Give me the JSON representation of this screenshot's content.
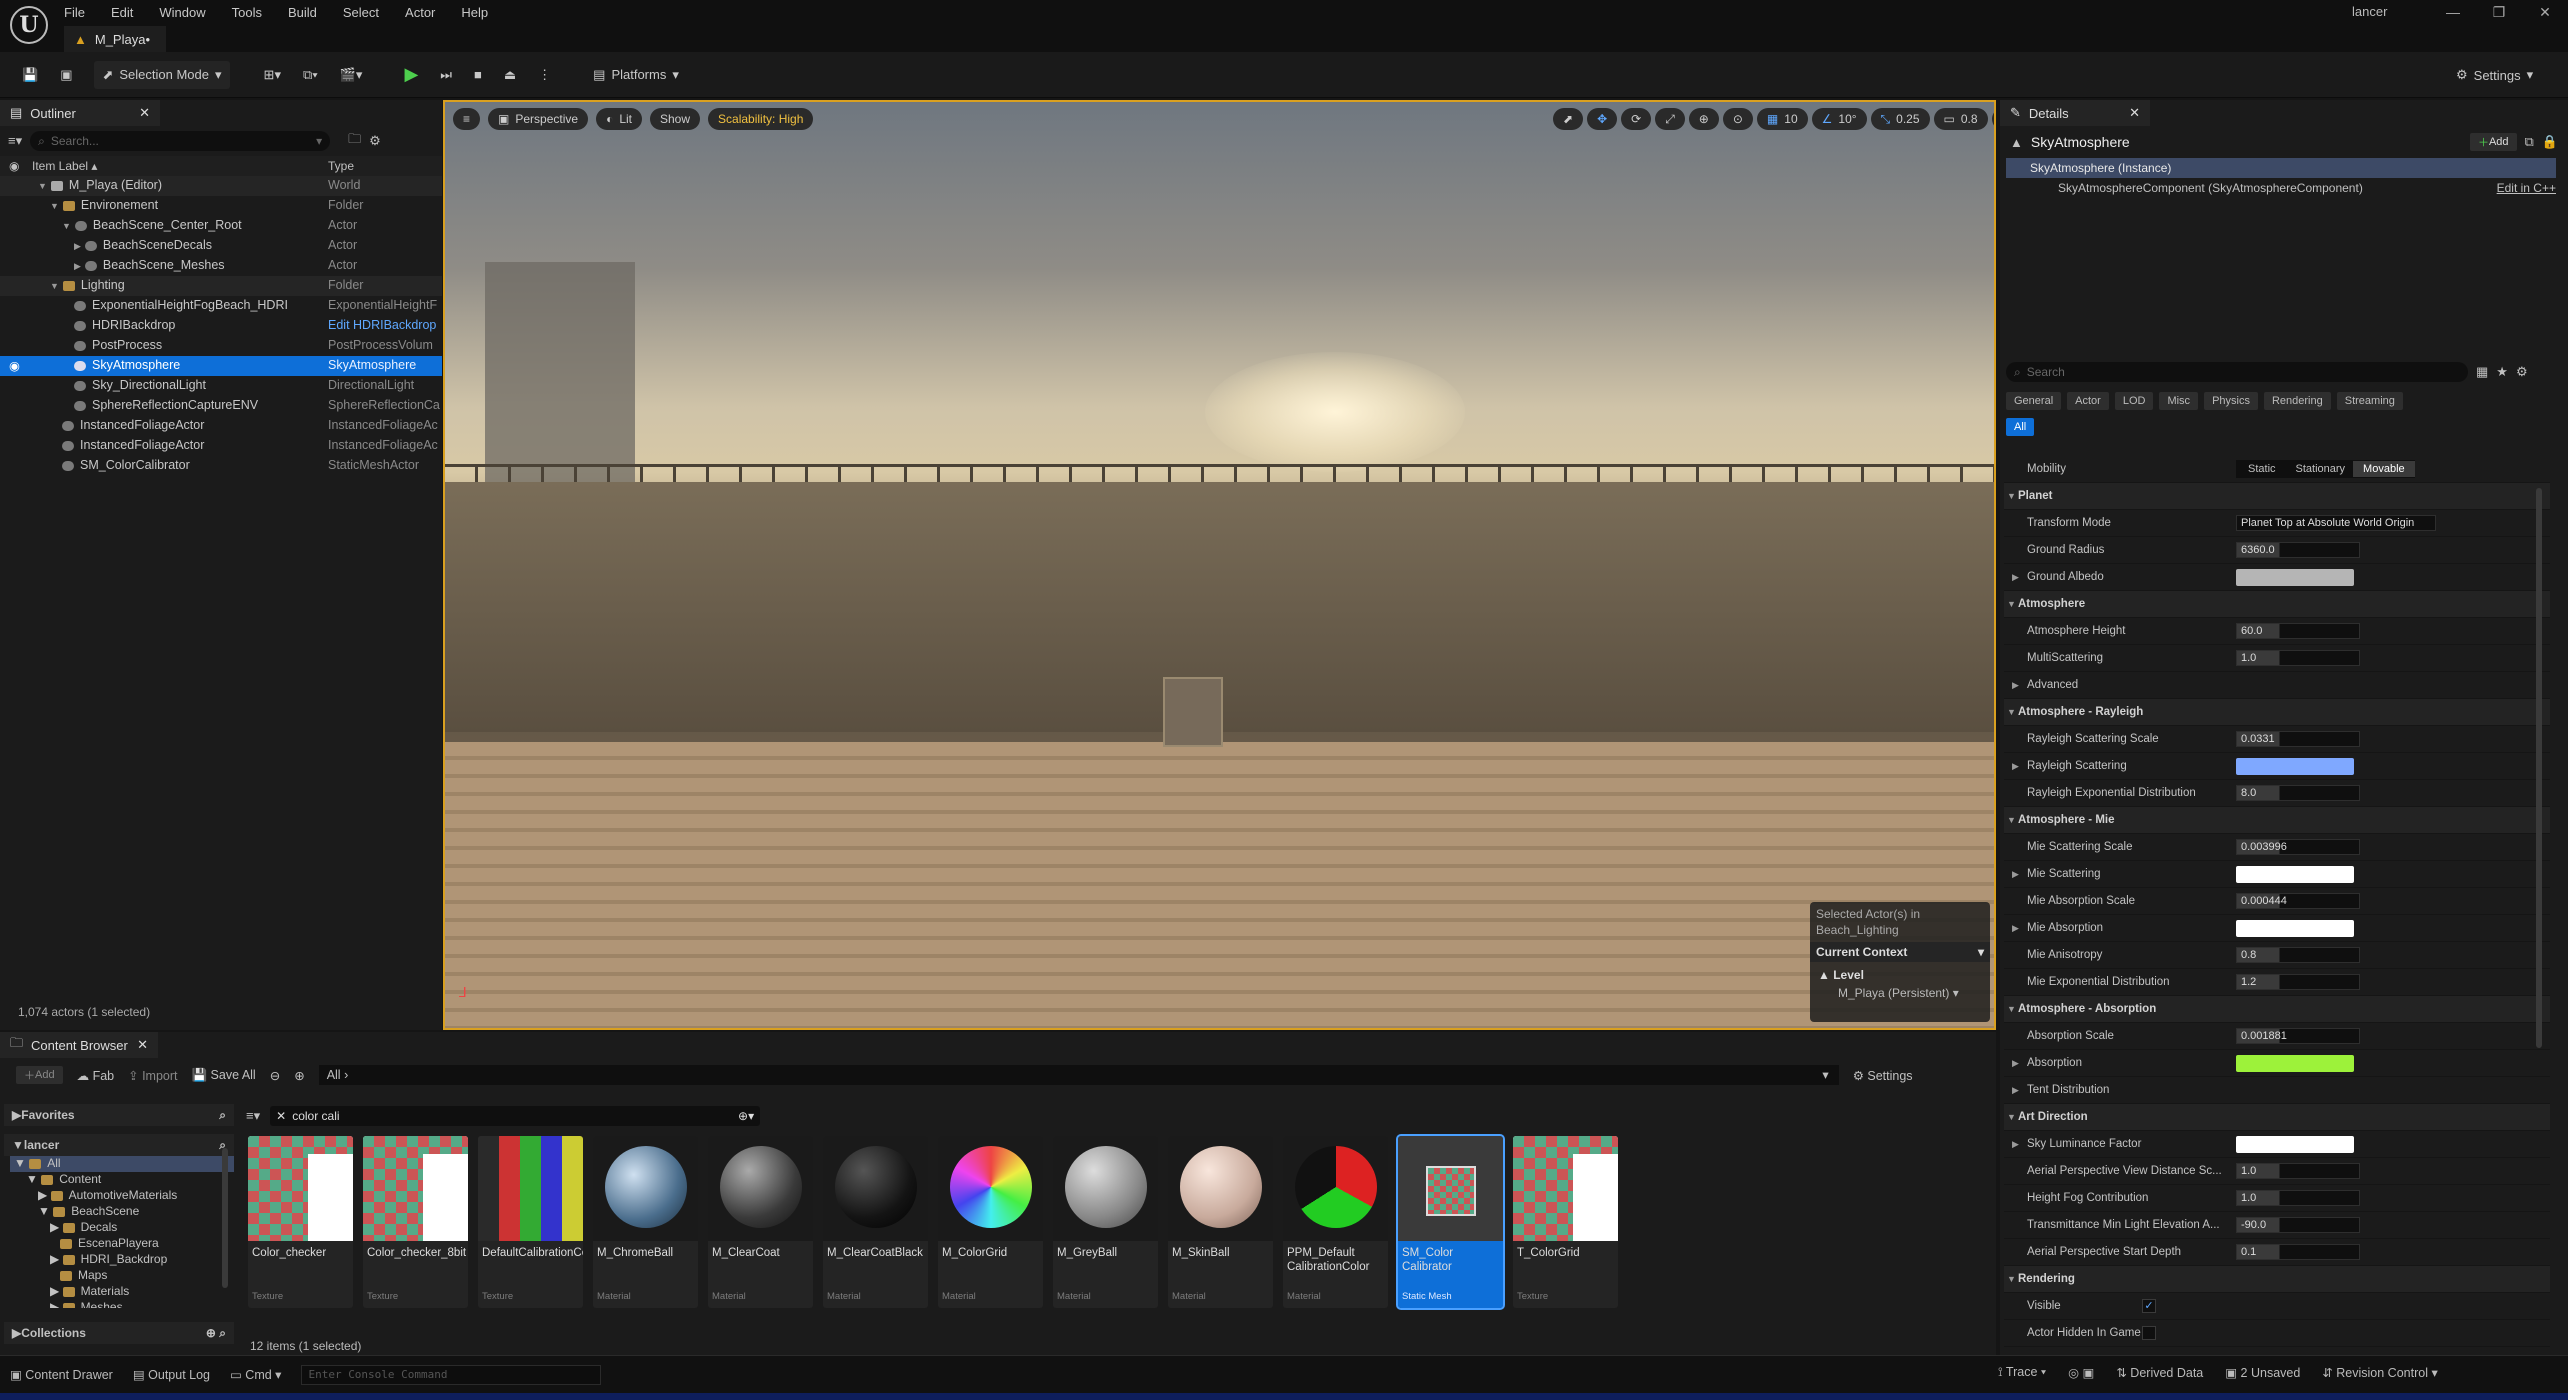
{
  "app": {
    "menu": [
      "File",
      "Edit",
      "Window",
      "Tools",
      "Build",
      "Select",
      "Actor",
      "Help"
    ],
    "doc_tab": "M_Playa•",
    "user": "lancer"
  },
  "toolbar": {
    "selection_mode": "Selection Mode",
    "platforms": "Platforms",
    "settings": "Settings"
  },
  "outliner": {
    "tab": "Outliner",
    "search_placeholder": "Search...",
    "col_label": "Item Label",
    "col_type": "Type",
    "rows": [
      {
        "label": "M_Playa (Editor)",
        "type": "World"
      },
      {
        "label": "Environement",
        "type": "Folder"
      },
      {
        "label": "BeachScene_Center_Root",
        "type": "Actor"
      },
      {
        "label": "BeachSceneDecals",
        "type": "Actor"
      },
      {
        "label": "BeachScene_Meshes",
        "type": "Actor"
      },
      {
        "label": "Lighting",
        "type": "Folder"
      },
      {
        "label": "ExponentialHeightFogBeach_HDRI",
        "type": "ExponentialHeightF"
      },
      {
        "label": "HDRIBackdrop",
        "type": "Edit HDRIBackdrop"
      },
      {
        "label": "PostProcess",
        "type": "PostProcessVolum"
      },
      {
        "label": "SkyAtmosphere",
        "type": "SkyAtmosphere"
      },
      {
        "label": "Sky_DirectionalLight",
        "type": "DirectionalLight"
      },
      {
        "label": "SphereReflectionCaptureENV",
        "type": "SphereReflectionCa"
      },
      {
        "label": "InstancedFoliageActor",
        "type": "InstancedFoliageAc"
      },
      {
        "label": "InstancedFoliageActor",
        "type": "InstancedFoliageAc"
      },
      {
        "label": "SM_ColorCalibrator",
        "type": "StaticMeshActor"
      }
    ],
    "footer": "1,074 actors (1 selected)"
  },
  "viewport": {
    "perspective": "Perspective",
    "lit": "Lit",
    "show": "Show",
    "scalability": "Scalability: High",
    "grid_snap": "10",
    "rot_snap": "10°",
    "scale_snap": "0.25",
    "cam_speed": "0.8",
    "ctx_selected": "Selected Actor(s) in",
    "ctx_level_name": "Beach_Lighting",
    "ctx_current": "Current Context",
    "ctx_level": "Level",
    "ctx_persistent": "M_Playa (Persistent)"
  },
  "details": {
    "tab": "Details",
    "actor_name": "SkyAtmosphere",
    "add": "Add",
    "instance": "SkyAtmosphere (Instance)",
    "component": "SkyAtmosphereComponent (SkyAtmosphereComponent)",
    "edit_cpp": "Edit in C++",
    "search_placeholder": "Search",
    "filters": [
      "General",
      "Actor",
      "LOD",
      "Misc",
      "Physics",
      "Rendering",
      "Streaming"
    ],
    "filter_all": "All",
    "mobility_label": "Mobility",
    "mobility_opts": [
      "Static",
      "Stationary",
      "Movable"
    ],
    "props": [
      {
        "kind": "sec",
        "label": "Planet"
      },
      {
        "kind": "drop",
        "label": "Transform Mode",
        "value": "Planet Top at Absolute World Origin"
      },
      {
        "kind": "num",
        "label": "Ground Radius",
        "value": "6360.0"
      },
      {
        "kind": "col",
        "label": "Ground Albedo",
        "color": "#b5b5b5",
        "exp": true
      },
      {
        "kind": "sec",
        "label": "Atmosphere"
      },
      {
        "kind": "num",
        "label": "Atmosphere Height",
        "value": "60.0"
      },
      {
        "kind": "num",
        "label": "MultiScattering",
        "value": "1.0"
      },
      {
        "kind": "plain",
        "label": "Advanced",
        "exp": true
      },
      {
        "kind": "sec",
        "label": "Atmosphere - Rayleigh"
      },
      {
        "kind": "num",
        "label": "Rayleigh Scattering Scale",
        "value": "0.0331"
      },
      {
        "kind": "col",
        "label": "Rayleigh Scattering",
        "color": "#7fa8ff",
        "exp": true
      },
      {
        "kind": "num",
        "label": "Rayleigh Exponential Distribution",
        "value": "8.0"
      },
      {
        "kind": "sec",
        "label": "Atmosphere - Mie"
      },
      {
        "kind": "num",
        "label": "Mie Scattering Scale",
        "value": "0.003996"
      },
      {
        "kind": "col",
        "label": "Mie Scattering",
        "color": "#ffffff",
        "exp": true
      },
      {
        "kind": "num",
        "label": "Mie Absorption Scale",
        "value": "0.000444"
      },
      {
        "kind": "col",
        "label": "Mie Absorption",
        "color": "#ffffff",
        "exp": true
      },
      {
        "kind": "num",
        "label": "Mie Anisotropy",
        "value": "0.8"
      },
      {
        "kind": "num",
        "label": "Mie Exponential Distribution",
        "value": "1.2"
      },
      {
        "kind": "sec",
        "label": "Atmosphere - Absorption"
      },
      {
        "kind": "num",
        "label": "Absorption Scale",
        "value": "0.001881"
      },
      {
        "kind": "col",
        "label": "Absorption",
        "color": "#9df23a",
        "exp": true
      },
      {
        "kind": "plain",
        "label": "Tent Distribution",
        "exp": true
      },
      {
        "kind": "sec",
        "label": "Art Direction"
      },
      {
        "kind": "col",
        "label": "Sky Luminance Factor",
        "color": "#ffffff",
        "exp": true
      },
      {
        "kind": "num",
        "label": "Aerial Perspective View Distance Sc...",
        "value": "1.0"
      },
      {
        "kind": "num",
        "label": "Height Fog Contribution",
        "value": "1.0"
      },
      {
        "kind": "num",
        "label": "Transmittance Min Light Elevation A...",
        "value": "-90.0"
      },
      {
        "kind": "num",
        "label": "Aerial Perspective Start Depth",
        "value": "0.1"
      },
      {
        "kind": "sec",
        "label": "Rendering"
      },
      {
        "kind": "check",
        "label": "Visible",
        "checked": true
      },
      {
        "kind": "check",
        "label": "Actor Hidden In Game",
        "checked": false
      }
    ]
  },
  "content_browser": {
    "tab": "Content Browser",
    "add": "Add",
    "fab": "Fab",
    "import": "Import",
    "save_all": "Save All",
    "path": "All",
    "settings": "Settings",
    "favorites": "Favorites",
    "root": "lancer",
    "tree": [
      "All",
      "Content",
      "AutomotiveMaterials",
      "BeachScene",
      "Decals",
      "EscenaPlayera",
      "HDRI_Backdrop",
      "Maps",
      "Materials",
      "Meshes"
    ],
    "collections": "Collections",
    "search": "color cali",
    "assets": [
      {
        "name": "Color_checker",
        "type": "Texture"
      },
      {
        "name": "Color_checker_8bit",
        "type": "Texture"
      },
      {
        "name": "DefaultCalibrationColor",
        "type": "Texture"
      },
      {
        "name": "M_ChromeBall",
        "type": "Material"
      },
      {
        "name": "M_ClearCoat",
        "type": "Material"
      },
      {
        "name": "M_ClearCoatBlack",
        "type": "Material"
      },
      {
        "name": "M_ColorGrid",
        "type": "Material"
      },
      {
        "name": "M_GreyBall",
        "type": "Material"
      },
      {
        "name": "M_SkinBall",
        "type": "Material"
      },
      {
        "name": "PPM_Default CalibrationColor",
        "type": "Material"
      },
      {
        "name": "SM_Color Calibrator",
        "type": "Static Mesh"
      },
      {
        "name": "T_ColorGrid",
        "type": "Texture"
      }
    ],
    "count": "12 items (1 selected)"
  },
  "statusbar": {
    "content_drawer": "Content Drawer",
    "output_log": "Output Log",
    "cmd": "Cmd",
    "console_placeholder": "Enter Console Command",
    "trace": "Trace",
    "derived_data": "Derived Data",
    "unsaved": "2 Unsaved",
    "revision": "Revision Control"
  }
}
